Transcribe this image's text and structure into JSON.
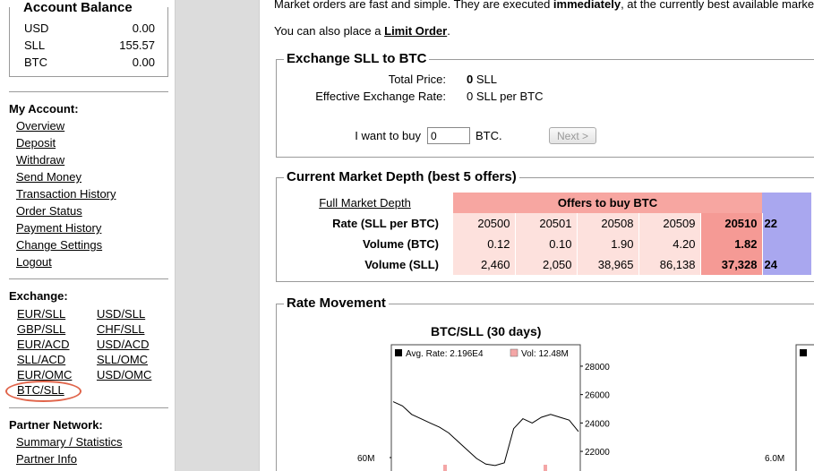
{
  "balance": {
    "title": "Account Balance",
    "rows": [
      {
        "currency": "USD",
        "amount": "0.00"
      },
      {
        "currency": "SLL",
        "amount": "155.57"
      },
      {
        "currency": "BTC",
        "amount": "0.00"
      }
    ]
  },
  "account": {
    "title": "My Account:",
    "links": [
      "Overview",
      "Deposit",
      "Withdraw",
      "Send Money",
      "Transaction History",
      "Order Status",
      "Payment History",
      "Change Settings",
      "Logout"
    ]
  },
  "exchange": {
    "title": "Exchange:",
    "pairs_left": [
      "EUR/SLL",
      "GBP/SLL",
      "EUR/ACD",
      "SLL/ACD",
      "EUR/OMC",
      "BTC/SLL"
    ],
    "pairs_right": [
      "USD/SLL",
      "CHF/SLL",
      "USD/ACD",
      "SLL/OMC",
      "USD/OMC"
    ]
  },
  "partner": {
    "title": "Partner Network:",
    "links": [
      "Summary / Statistics",
      "Partner Info"
    ]
  },
  "intro": {
    "line1_a": "Market orders are fast and simple. They are executed ",
    "line1_b": "immediately",
    "line1_c": ", at the currently best available market",
    "line2_a": "You can also place a ",
    "line2_link": "Limit Order",
    "line2_c": "."
  },
  "exchange_form": {
    "title": "Exchange SLL to BTC",
    "total_price_label": "Total Price:",
    "total_price_value": "0",
    "total_price_unit": " SLL",
    "rate_label": "Effective Exchange Rate:",
    "rate_value": "0 SLL per BTC",
    "buy_label": "I want to buy",
    "buy_value": "0",
    "buy_unit": "BTC.",
    "next_label": "Next >"
  },
  "depth": {
    "title": "Current Market Depth (best 5 offers)",
    "full_link": "Full Market Depth",
    "offers_header": "Offers to buy BTC",
    "rows": [
      {
        "label": "Rate (SLL per BTC)",
        "values": [
          "20500",
          "20501",
          "20508",
          "20509",
          "20510"
        ],
        "next": "22"
      },
      {
        "label": "Volume (BTC)",
        "values": [
          "0.12",
          "0.10",
          "1.90",
          "4.20",
          "1.82"
        ],
        "next": ""
      },
      {
        "label": "Volume (SLL)",
        "values": [
          "2,460",
          "2,050",
          "38,965",
          "86,138",
          "37,328"
        ],
        "next": "24"
      }
    ]
  },
  "rate_movement": {
    "title": "Rate Movement",
    "chart_title": "BTC/SLL (30 days)",
    "legend_rate": "Avg. Rate: 2.196E4",
    "legend_vol": "Vol: 12.48M",
    "y_ticks": [
      "28000",
      "26000",
      "24000",
      "22000"
    ],
    "vol_tick": "60M",
    "vol_tick_right": "6.0M"
  },
  "chart_data": {
    "type": "line",
    "title": "BTC/SLL (30 days)",
    "series": [
      {
        "name": "Avg. Rate: 2.196E4",
        "x": [
          0,
          1,
          2,
          3,
          4,
          5,
          6,
          7,
          8,
          9,
          10,
          11,
          12,
          13,
          14,
          15,
          16,
          17,
          18,
          19,
          20
        ],
        "values": [
          25500,
          25200,
          24600,
          24300,
          24000,
          23700,
          23300,
          22700,
          22100,
          21500,
          21100,
          21000,
          21200,
          23600,
          24300,
          24000,
          24400,
          24600,
          24400,
          24200,
          23400
        ]
      }
    ],
    "ylim": [
      21500,
      28500
    ],
    "yticks": [
      22000,
      24000,
      26000,
      28000
    ],
    "volume_series_name": "Vol: 12.48M"
  },
  "colors": {
    "offer_light": "#fde1dd",
    "offer_best": "#f59a95",
    "offer_header": "#f7a6a1",
    "bid_blue": "#a9a7ef",
    "highlight_ring": "#e0644a"
  }
}
